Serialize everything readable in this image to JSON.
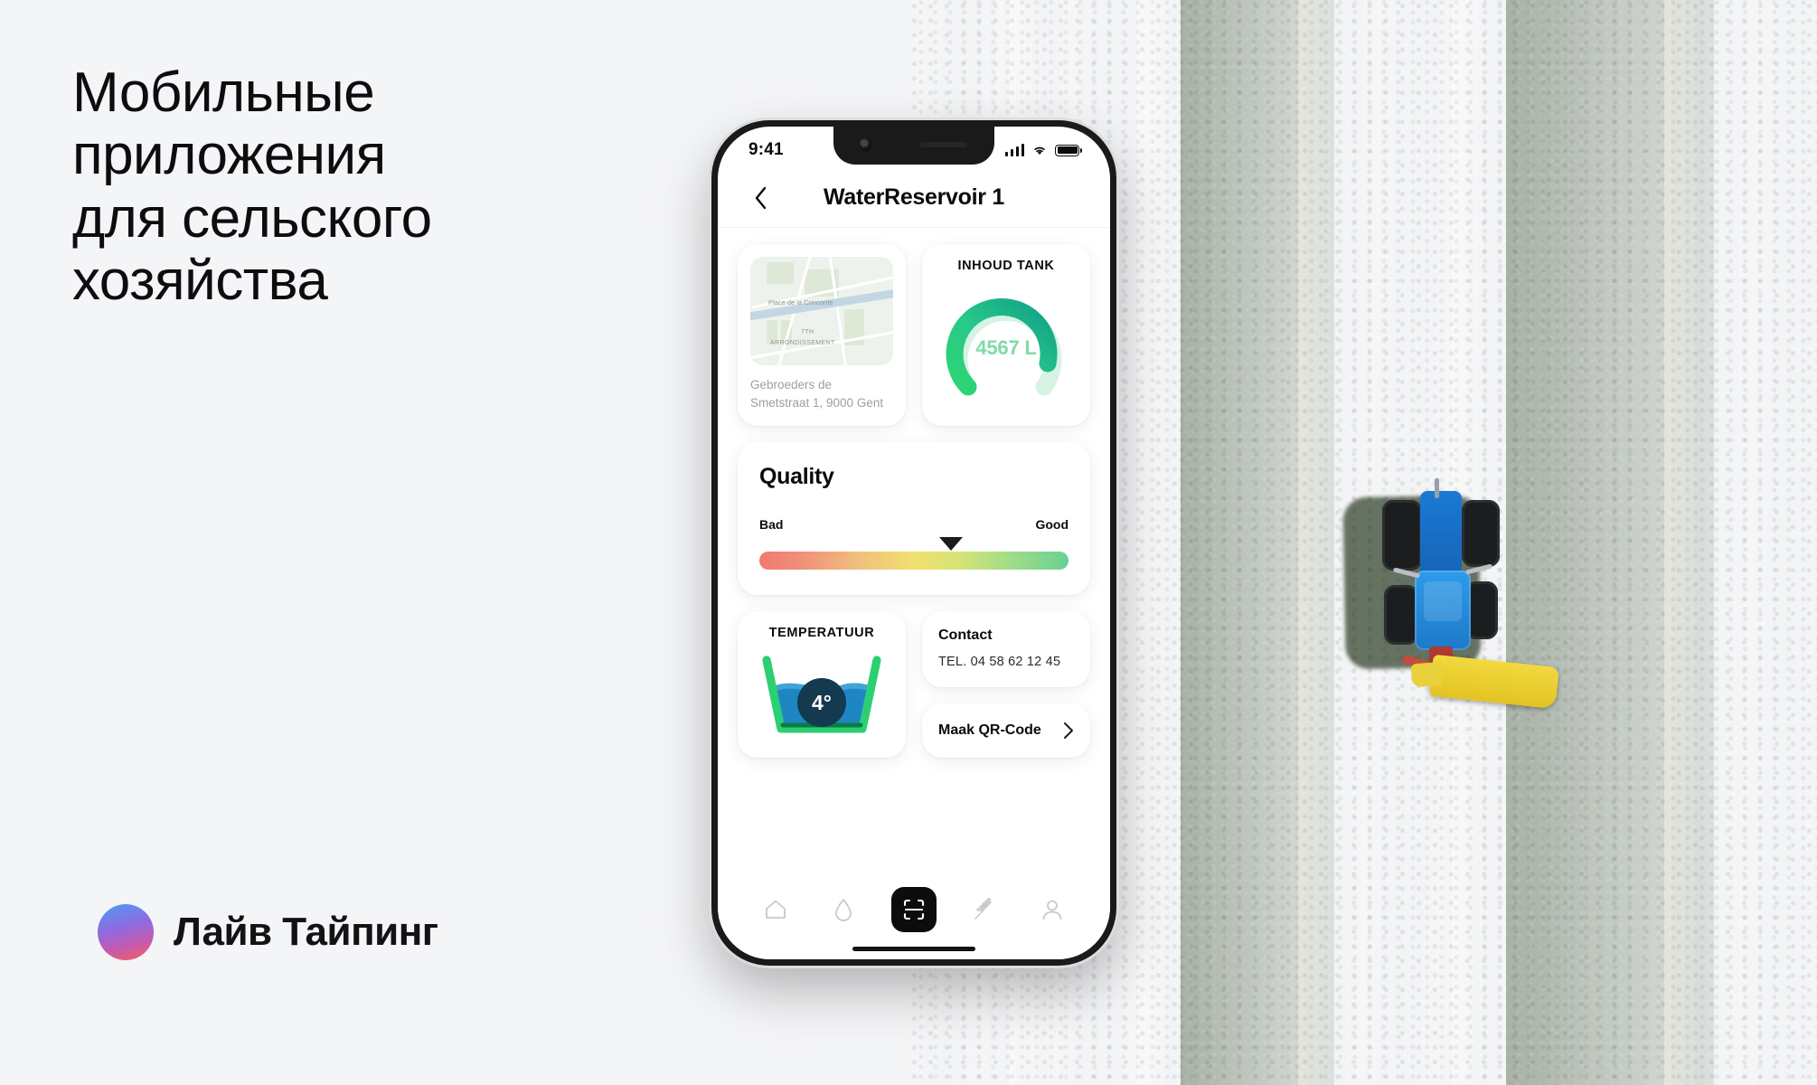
{
  "page": {
    "headline_lines": [
      "Мобильные",
      "приложения",
      "для сельского",
      "хозяйства"
    ],
    "brand_name": "Лайв Тайпинг",
    "brand_mark_icon": "gradient-circle-logo-icon",
    "background_photo_alt": "aerial-tractor-mowing-field"
  },
  "phone": {
    "status_bar": {
      "time": "9:41",
      "signal_icon": "cellular-bars-icon",
      "wifi_icon": "wifi-icon",
      "battery_icon": "battery-full-icon"
    },
    "nav": {
      "back_icon": "chevron-left-icon",
      "title": "WaterReservoir 1"
    },
    "map_card": {
      "map_icon": "map-thumbnail-icon",
      "map_labels": {
        "street": "Place de la Concorde",
        "district_line1": "7TH",
        "district_line2": "ARRONDISSEMENT"
      },
      "address": "Gebroeders de Smetstraat 1, 9000 Gent"
    },
    "tank_card": {
      "title": "INHOUD TANK",
      "value": "4567 L",
      "gauge_icon": "circular-gauge-icon",
      "fill_percent": 85,
      "gauge_color_start": "#2ed573",
      "gauge_color_end": "#16a37f",
      "gauge_track_color": "#d6f3e3",
      "value_color": "#7fdba6"
    },
    "quality_card": {
      "title": "Quality",
      "label_bad": "Bad",
      "label_good": "Good",
      "marker_icon": "triangle-down-marker-icon",
      "marker_percent": 62,
      "gradient_stops": [
        "#f2796f",
        "#f2e06f",
        "#69d094"
      ]
    },
    "temperature_card": {
      "title": "TEMPERATUUR",
      "value": "4°",
      "basin_icon": "water-basin-icon",
      "water_color": "#1f86c4",
      "basin_color": "#2ed573",
      "badge_color": "#133a4f"
    },
    "contact_card": {
      "title": "Contact",
      "phone": "TEL. 04 58 62 12 45"
    },
    "qr_card": {
      "label": "Maak QR-Code",
      "chevron_icon": "chevron-right-icon"
    },
    "tabbar": {
      "items": [
        {
          "name": "home",
          "icon": "home-icon",
          "active": false
        },
        {
          "name": "water",
          "icon": "water-drop-icon",
          "active": false
        },
        {
          "name": "scan",
          "icon": "scan-frame-icon",
          "active": true
        },
        {
          "name": "crops",
          "icon": "wheat-icon",
          "active": false
        },
        {
          "name": "profile",
          "icon": "person-icon",
          "active": false
        }
      ]
    }
  }
}
